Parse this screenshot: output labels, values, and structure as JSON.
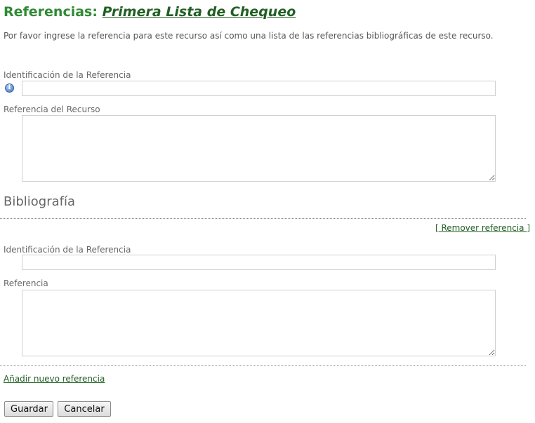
{
  "header": {
    "title_prefix": "Referencias: ",
    "title_link": "Primera Lista de Chequeo",
    "intro": "Por favor ingrese la referencia para este recurso así como una lista de las referencias bibliográficas de este recurso."
  },
  "form": {
    "ref_id_label": "Identificación de la Referencia",
    "ref_id_value": "",
    "resource_ref_label": "Referencia del Recurso",
    "resource_ref_value": ""
  },
  "bibliography": {
    "heading": "Bibliografía",
    "remove_link": "[ Remover referencia ]",
    "entries": [
      {
        "id_label": "Identificación de la Referencia",
        "id_value": "",
        "ref_label": "Referencia",
        "ref_value": ""
      }
    ],
    "add_link": "Añadir nuevo referencia"
  },
  "actions": {
    "save_label": "Guardar",
    "cancel_label": "Cancelar"
  },
  "icons": {
    "info": "info-icon"
  }
}
